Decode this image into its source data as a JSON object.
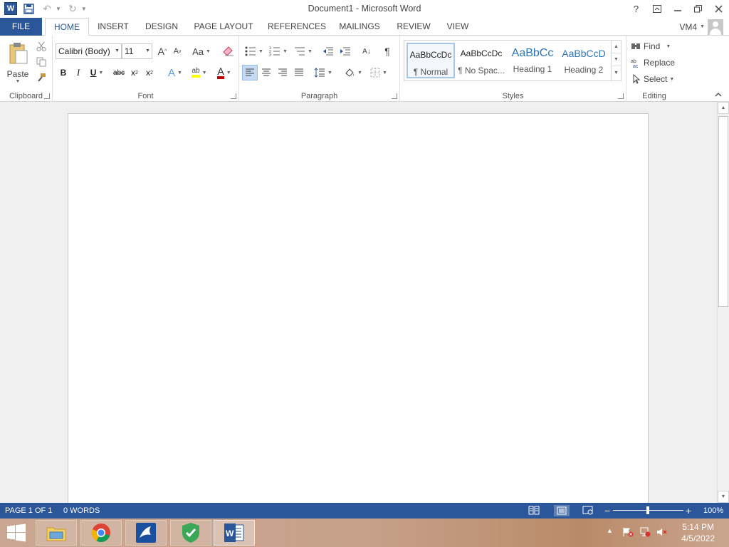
{
  "window": {
    "title": "Document1 - Microsoft Word",
    "app_icon": "W",
    "help": "?",
    "user": "VM4"
  },
  "tabs": [
    "FILE",
    "HOME",
    "INSERT",
    "DESIGN",
    "PAGE LAYOUT",
    "REFERENCES",
    "MAILINGS",
    "REVIEW",
    "VIEW"
  ],
  "ribbon": {
    "clipboard": {
      "paste_label": "Paste",
      "group_label": "Clipboard"
    },
    "font": {
      "font_name": "Calibri (Body)",
      "font_size": "11",
      "grow": "A",
      "shrink": "A",
      "change_case": "Aa",
      "bold": "B",
      "italic": "I",
      "underline": "U",
      "strike": "abc",
      "subscript": "x",
      "superscript": "x",
      "text_effects": "A",
      "highlight": "ab",
      "font_color": "A",
      "group_label": "Font"
    },
    "paragraph": {
      "show_marks": "¶",
      "sort": "A↓",
      "group_label": "Paragraph"
    },
    "styles": {
      "group_label": "Styles",
      "items": [
        {
          "sample": "AaBbCcDc",
          "name": "¶ Normal"
        },
        {
          "sample": "AaBbCcDc",
          "name": "¶ No Spac..."
        },
        {
          "sample": "AaBbCc",
          "name": "Heading 1"
        },
        {
          "sample": "AaBbCcD",
          "name": "Heading 2"
        }
      ]
    },
    "editing": {
      "find": "Find",
      "replace": "Replace",
      "select": "Select",
      "group_label": "Editing"
    }
  },
  "status": {
    "page": "PAGE 1 OF 1",
    "words": "0 WORDS",
    "zoom": "100%"
  },
  "taskbar": {
    "time": "5:14 PM",
    "date": "4/5/2022"
  },
  "colors": {
    "accent": "#2b579a",
    "highlight": "#ffff00",
    "font_color": "#c00000"
  }
}
